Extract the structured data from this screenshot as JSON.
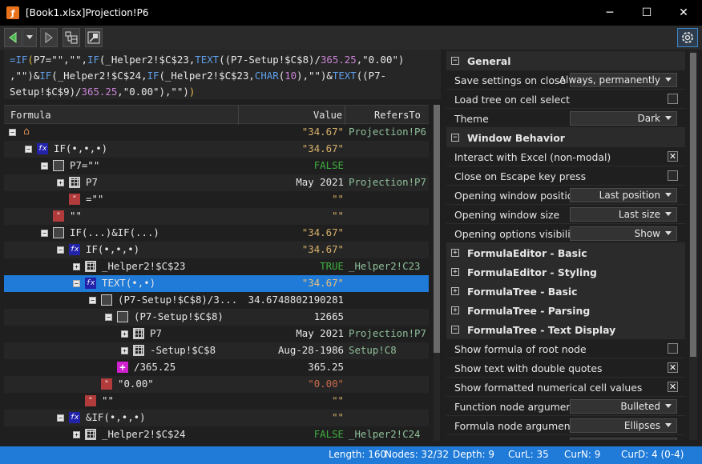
{
  "window": {
    "title": "[Book1.xlsx]Projection!P6"
  },
  "formula_lines": [
    [
      [
        "fk",
        "=IF"
      ],
      [
        "pa",
        "("
      ],
      [
        "fs",
        "P7=\"\",\"\","
      ],
      [
        "fk",
        "IF"
      ],
      [
        "fs",
        "(_Helper2!$C$23,"
      ],
      [
        "fk",
        "TEXT"
      ],
      [
        "fs",
        "(("
      ],
      [
        "fs",
        "P7-Setup!$C$8"
      ],
      [
        "fs",
        ")/"
      ],
      [
        "fn",
        "365.25"
      ],
      [
        "fs",
        ",\"0.00\")"
      ]
    ],
    [
      [
        "fs",
        ",\"\")&"
      ],
      [
        "fk",
        "IF"
      ],
      [
        "fs",
        "(_Helper2!$C$24,"
      ],
      [
        "fk",
        "IF"
      ],
      [
        "fs",
        "(_Helper2!$C$23,"
      ],
      [
        "fk",
        "CHAR"
      ],
      [
        "fs",
        "("
      ],
      [
        "fn",
        "10"
      ],
      [
        "fs",
        "),\"\")&"
      ],
      [
        "fk",
        "TEXT"
      ],
      [
        "fs",
        "((P7-"
      ]
    ],
    [
      [
        "fs",
        "Setup!$C$9)/"
      ],
      [
        "fn",
        "365.25"
      ],
      [
        "fs",
        ",\"0.00\"),\"\")"
      ],
      [
        "pa",
        ")"
      ]
    ]
  ],
  "tree": {
    "columns": {
      "formula": "Formula",
      "value": "Value",
      "refers_to": "RefersTo"
    },
    "rows": [
      {
        "depth": 0,
        "exp": "−",
        "icon": "home",
        "label": "",
        "value": "\"34.67\"",
        "vclass": "v-str",
        "ref": "Projection!P6"
      },
      {
        "depth": 1,
        "exp": "−",
        "icon": "fx",
        "label": "IF(•,•,•)",
        "value": "\"34.67\"",
        "vclass": "v-str",
        "ref": ""
      },
      {
        "depth": 2,
        "exp": "−",
        "icon": "box",
        "label": "P7=\"\"",
        "value": "FALSE",
        "vclass": "v-false",
        "ref": ""
      },
      {
        "depth": 3,
        "exp": "+",
        "icon": "grid",
        "label": "P7",
        "value": "May 2021",
        "vclass": "v-plain",
        "ref": "Projection!P7"
      },
      {
        "depth": 3,
        "exp": "",
        "icon": "str",
        "label": "=\"\"",
        "value": "\"\"",
        "vclass": "v-str",
        "ref": ""
      },
      {
        "depth": 2,
        "exp": "",
        "icon": "str",
        "label": "\"\"",
        "value": "\"\"",
        "vclass": "v-str",
        "ref": ""
      },
      {
        "depth": 2,
        "exp": "−",
        "icon": "box",
        "label": "IF(...)&IF(...)",
        "value": "\"34.67\"",
        "vclass": "v-str",
        "ref": ""
      },
      {
        "depth": 3,
        "exp": "−",
        "icon": "fx",
        "label": "IF(•,•,•)",
        "value": "\"34.67\"",
        "vclass": "v-str",
        "ref": ""
      },
      {
        "depth": 4,
        "exp": "+",
        "icon": "grid",
        "label": "_Helper2!$C$23",
        "value": "TRUE",
        "vclass": "v-true",
        "ref": "_Helper2!C23"
      },
      {
        "depth": 4,
        "exp": "−",
        "icon": "fx",
        "label": "TEXT(•,•)",
        "value": "\"34.67\"",
        "vclass": "v-str",
        "ref": "",
        "selected": true
      },
      {
        "depth": 5,
        "exp": "−",
        "icon": "box",
        "label": "(P7-Setup!$C$8)/3...",
        "value": "34.6748802190281",
        "vclass": "v-plain",
        "ref": ""
      },
      {
        "depth": 6,
        "exp": "−",
        "icon": "box",
        "label": "(P7-Setup!$C$8)",
        "value": "12665",
        "vclass": "v-plain",
        "ref": ""
      },
      {
        "depth": 7,
        "exp": "+",
        "icon": "grid",
        "label": "P7",
        "value": "May 2021",
        "vclass": "v-plain",
        "ref": "Projection!P7"
      },
      {
        "depth": 7,
        "exp": "+",
        "icon": "grid",
        "label": "-Setup!$C$8",
        "value": "Aug-28-1986",
        "vclass": "v-plain",
        "ref": "Setup!C8"
      },
      {
        "depth": 6,
        "exp": "",
        "icon": "plus",
        "label": "/365.25",
        "value": "365.25",
        "vclass": "v-plain",
        "ref": ""
      },
      {
        "depth": 5,
        "exp": "",
        "icon": "str",
        "label": "\"0.00\"",
        "value": "\"0.00\"",
        "vclass": "v-red",
        "ref": ""
      },
      {
        "depth": 4,
        "exp": "",
        "icon": "str",
        "label": "\"\"",
        "value": "\"\"",
        "vclass": "v-str",
        "ref": ""
      },
      {
        "depth": 3,
        "exp": "−",
        "icon": "fx",
        "label": "&IF(•,•,•)",
        "value": "\"\"",
        "vclass": "v-str",
        "ref": ""
      },
      {
        "depth": 4,
        "exp": "+",
        "icon": "grid",
        "label": "_Helper2!$C$24",
        "value": "FALSE",
        "vclass": "v-false",
        "ref": "_Helper2!C24"
      }
    ]
  },
  "options": [
    {
      "type": "cat",
      "label": "General",
      "exp": "−"
    },
    {
      "type": "dd",
      "label": "Save settings on close",
      "value": "Always, permanently"
    },
    {
      "type": "cb",
      "label": "Load tree on cell select",
      "checked": false
    },
    {
      "type": "dd",
      "label": "Theme",
      "value": "Dark"
    },
    {
      "type": "cat",
      "label": "Window Behavior",
      "exp": "−"
    },
    {
      "type": "cb",
      "label": "Interact with Excel (non-modal)",
      "checked": true
    },
    {
      "type": "cb",
      "label": "Close on Escape key press",
      "checked": false
    },
    {
      "type": "dd",
      "label": "Opening window position",
      "value": "Last position"
    },
    {
      "type": "dd",
      "label": "Opening window size",
      "value": "Last size"
    },
    {
      "type": "dd",
      "label": "Opening options visibility",
      "value": "Show"
    },
    {
      "type": "cat",
      "label": "FormulaEditor - Basic",
      "exp": "+"
    },
    {
      "type": "cat",
      "label": "FormulaEditor - Styling",
      "exp": "+"
    },
    {
      "type": "cat",
      "label": "FormulaTree - Basic",
      "exp": "+"
    },
    {
      "type": "cat",
      "label": "FormulaTree - Parsing",
      "exp": "+"
    },
    {
      "type": "cat",
      "label": "FormulaTree - Text Display",
      "exp": "−"
    },
    {
      "type": "cb",
      "label": "Show formula of root node",
      "checked": false
    },
    {
      "type": "cb",
      "label": "Show text with double quotes",
      "checked": true
    },
    {
      "type": "cb",
      "label": "Show formatted numerical cell values",
      "checked": true
    },
    {
      "type": "dd",
      "label": "Function node arguments",
      "value": "Bulleted"
    },
    {
      "type": "dd",
      "label": "Formula node arguments",
      "value": "Ellipses"
    },
    {
      "type": "dd",
      "label": "",
      "value": ""
    }
  ],
  "status": {
    "length": "Length: 160",
    "nodes": "Nodes: 32/32",
    "depth": "Depth: 9",
    "curl": "CurL: 35",
    "curn": "CurN: 9",
    "curd": "CurD: 4 (0-4)"
  }
}
